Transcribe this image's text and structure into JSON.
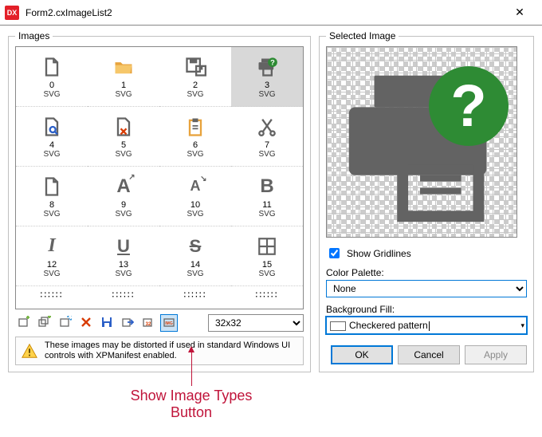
{
  "window": {
    "app_icon_text": "DX",
    "title": "Form2.cxImageList2"
  },
  "groups": {
    "images_label": "Images",
    "selected_label": "Selected Image"
  },
  "images": [
    {
      "idx": "0",
      "type": "SVG",
      "icon": "new-file",
      "selected": false
    },
    {
      "idx": "1",
      "type": "SVG",
      "icon": "open-folder",
      "selected": false
    },
    {
      "idx": "2",
      "type": "SVG",
      "icon": "save-as",
      "selected": false
    },
    {
      "idx": "3",
      "type": "SVG",
      "icon": "print-help",
      "selected": true
    },
    {
      "idx": "4",
      "type": "SVG",
      "icon": "page-search",
      "selected": false
    },
    {
      "idx": "5",
      "type": "SVG",
      "icon": "page-delete",
      "selected": false
    },
    {
      "idx": "6",
      "type": "SVG",
      "icon": "clipboard",
      "selected": false
    },
    {
      "idx": "7",
      "type": "SVG",
      "icon": "cut",
      "selected": false
    },
    {
      "idx": "8",
      "type": "SVG",
      "icon": "blank-page",
      "selected": false
    },
    {
      "idx": "9",
      "type": "SVG",
      "icon": "font-a",
      "selected": false
    },
    {
      "idx": "10",
      "type": "SVG",
      "icon": "font-shrink",
      "selected": false
    },
    {
      "idx": "11",
      "type": "SVG",
      "icon": "bold",
      "selected": false
    },
    {
      "idx": "12",
      "type": "SVG",
      "icon": "italic",
      "selected": false
    },
    {
      "idx": "13",
      "type": "SVG",
      "icon": "underline",
      "selected": false
    },
    {
      "idx": "14",
      "type": "SVG",
      "icon": "strike",
      "selected": false
    },
    {
      "idx": "15",
      "type": "SVG",
      "icon": "borders",
      "selected": false
    }
  ],
  "toolbar": {
    "buttons": [
      {
        "name": "add-image",
        "color": "#7ab648"
      },
      {
        "name": "add-images",
        "color": "#7ab648"
      },
      {
        "name": "replace-image",
        "color": "#2b8ed6"
      },
      {
        "name": "delete-image",
        "color": "#d83b01"
      },
      {
        "name": "save-image",
        "color": "#2b5fc7"
      },
      {
        "name": "export-image",
        "color": "#2b5fc7"
      },
      {
        "name": "image-size",
        "color": "#d83b01"
      },
      {
        "name": "show-image-types",
        "color": "#d83b01"
      }
    ],
    "size_value": "32x32"
  },
  "warning": "These images may be distorted if used in standard Windows UI controls with XPManifest enabled.",
  "selected_panel": {
    "show_gridlines_label": "Show Gridlines",
    "show_gridlines_checked": true,
    "color_palette_label": "Color Palette:",
    "color_palette_value": "None",
    "background_fill_label": "Background Fill:",
    "background_fill_value": "Checkered pattern"
  },
  "buttons": {
    "ok": "OK",
    "cancel": "Cancel",
    "apply": "Apply"
  },
  "annotation": "Show Image Types\nButton"
}
